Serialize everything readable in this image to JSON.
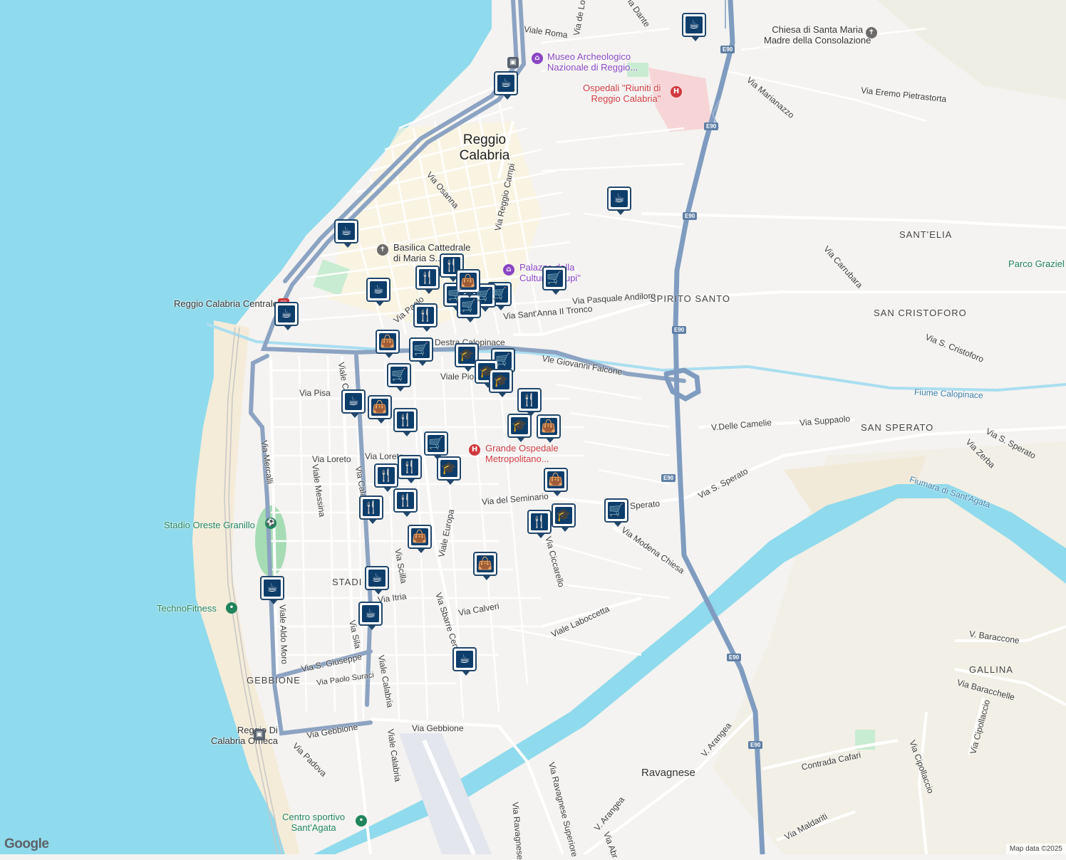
{
  "map": {
    "city_label": "Reggio\nCalabria",
    "places": [
      {
        "id": "ravagnese",
        "label": "Ravagnese"
      }
    ],
    "areas": [
      {
        "id": "santelia",
        "label": "SANT'ELIA"
      },
      {
        "id": "spirito-santo",
        "label": "SPIRITO SANTO"
      },
      {
        "id": "san-cristoforo",
        "label": "SAN CRISTOFORO"
      },
      {
        "id": "san-sperato",
        "label": "SAN SPERATO"
      },
      {
        "id": "stadio",
        "label": "STADI"
      },
      {
        "id": "gebbione",
        "label": "GEBBIONE"
      },
      {
        "id": "gallina",
        "label": "GALLINA"
      }
    ],
    "pois": [
      {
        "id": "museo",
        "label": "Museo Archeologico\nNazionale di Reggio...",
        "color": "purple"
      },
      {
        "id": "ospedali",
        "label": "Ospedali \"Riuniti di\nReggio Calabria\"",
        "color": "red"
      },
      {
        "id": "chiesa",
        "label": "Chiesa di Santa Maria\nMadre della Consolazione",
        "color": "dark"
      },
      {
        "id": "basilica",
        "label": "Basilica Cattedrale\ndi Maria S...",
        "color": "dark"
      },
      {
        "id": "palazzo",
        "label": "Palazzo della\nCultura \"Crupi\"",
        "color": "purple"
      },
      {
        "id": "stazione",
        "label": "Reggio Calabria Centrale",
        "color": "dark"
      },
      {
        "id": "grande-ospedale",
        "label": "Grande Ospedale\nMetropolitano...",
        "color": "red"
      },
      {
        "id": "stadio-granillo",
        "label": "Stadio Oreste Granillo",
        "color": "green"
      },
      {
        "id": "technofitness",
        "label": "TechnoFitness",
        "color": "green"
      },
      {
        "id": "omeca",
        "label": "Reggio Di\nCalabria Omeca",
        "color": "dark"
      },
      {
        "id": "centro-sportivo",
        "label": "Centro sportivo\nSant'Agata",
        "color": "green"
      },
      {
        "id": "parco",
        "label": "Parco Graziel",
        "color": "green"
      }
    ],
    "streets": [
      {
        "id": "viale-roma",
        "label": "Viale Roma"
      },
      {
        "id": "via-de-lo",
        "label": "Via de Lo"
      },
      {
        "id": "via-dante",
        "label": "Via Dante"
      },
      {
        "id": "via-osanna",
        "label": "Via Osanna"
      },
      {
        "id": "via-reggio-campi",
        "label": "Via Reggio Campi"
      },
      {
        "id": "via-marianazzo",
        "label": "Via Marianazzo"
      },
      {
        "id": "via-eremo",
        "label": "Via Eremo Pietrastorta"
      },
      {
        "id": "via-pasquale-andiloro",
        "label": "Via Pasquale Andiloro"
      },
      {
        "id": "via-santanna",
        "label": "Via Sant'Anna II Tronco"
      },
      {
        "id": "via-carrubara",
        "label": "Via Carrubara"
      },
      {
        "id": "via-s-cristoforo",
        "label": "Via S. Cristoforo"
      },
      {
        "id": "via-paolo",
        "label": "Via Paolo"
      },
      {
        "id": "destra-calopinace",
        "label": "Destra Calopinace"
      },
      {
        "id": "vle-giovanni-falcone",
        "label": "Vle Giovanni Falcone"
      },
      {
        "id": "viale-pio",
        "label": "Viale Pio X"
      },
      {
        "id": "fiume-calopinace",
        "label": "Fiume Calopinace"
      },
      {
        "id": "via-pisa",
        "label": "Via Pisa"
      },
      {
        "id": "v-delle-camelie",
        "label": "V.Delle Camelie"
      },
      {
        "id": "via-suppaolo",
        "label": "Via Suppaolo"
      },
      {
        "id": "via-s-sperato-1",
        "label": "Via S. Sperato"
      },
      {
        "id": "via-s-sperato-2",
        "label": "Via S. Sperato"
      },
      {
        "id": "via-zerba",
        "label": "Via Zerba"
      },
      {
        "id": "fiumara",
        "label": "Fiumara di Sant'Agata"
      },
      {
        "id": "via-loreto-1",
        "label": "Via Loreto"
      },
      {
        "id": "via-loreto-2",
        "label": "Via Loreto"
      },
      {
        "id": "via-del-seminario",
        "label": "Via del Seminario"
      },
      {
        "id": "via-sperato-short",
        "label": "Sperato"
      },
      {
        "id": "via-modena-chiesa",
        "label": "Via Modena Chiesa"
      },
      {
        "id": "viale-europa",
        "label": "Viale Europa"
      },
      {
        "id": "via-ciccarello",
        "label": "Via Ciccarello"
      },
      {
        "id": "viale-messina",
        "label": "Viale Messina"
      },
      {
        "id": "via-mercalli",
        "label": "Via Mercalli"
      },
      {
        "id": "via-scilla",
        "label": "Via Scilla"
      },
      {
        "id": "via-itria",
        "label": "Via Itria"
      },
      {
        "id": "via-calveri",
        "label": "Via Calveri"
      },
      {
        "id": "viale-laboccetta",
        "label": "Viale Laboccetta"
      },
      {
        "id": "via-sbarre-centrali",
        "label": "Via Sbarre Centrali"
      },
      {
        "id": "viale-aldo-moro",
        "label": "Viale Aldo Moro"
      },
      {
        "id": "via-sila",
        "label": "Via Sila"
      },
      {
        "id": "via-s-giuseppe",
        "label": "Via S. Giuseppe"
      },
      {
        "id": "via-paolo-suraci",
        "label": "Via Paolo Suraci"
      },
      {
        "id": "viale-calabria-1",
        "label": "Viale Calabria"
      },
      {
        "id": "viale-calabria-2",
        "label": "Viale Calabria"
      },
      {
        "id": "via-gebbione-1",
        "label": "Via Gebbione"
      },
      {
        "id": "via-gebbione-2",
        "label": "Via Gebbione"
      },
      {
        "id": "via-padova",
        "label": "Via Padova"
      },
      {
        "id": "via-ravagnese-sup",
        "label": "Via Ravagnese Superiore"
      },
      {
        "id": "via-ravagnese",
        "label": "Via Ravagnese"
      },
      {
        "id": "v-arangea-1",
        "label": "V. Arangea"
      },
      {
        "id": "v-arangea-2",
        "label": "V. Arangea"
      },
      {
        "id": "via-abr",
        "label": "Via Abr"
      },
      {
        "id": "contrada-cafari",
        "label": "Contrada Cafari"
      },
      {
        "id": "via-maldariti",
        "label": "Via Maldariti"
      },
      {
        "id": "via-cipollaccio-1",
        "label": "Via Cipollaccio"
      },
      {
        "id": "via-cipollaccio-2",
        "label": "Via Cipollaccio"
      },
      {
        "id": "v-baraccone",
        "label": "V. Baraccone"
      },
      {
        "id": "via-baracchelle",
        "label": "Via Baracchelle"
      },
      {
        "id": "viale-ce",
        "label": "Viale Ce"
      },
      {
        "id": "via-calabria-short",
        "label": "Via Calabria"
      }
    ],
    "highway_shield": "E90",
    "markers": {
      "coffee": "☕",
      "restaurant": "🍴",
      "cart": "🛒",
      "bag": "👜",
      "school": "🎓"
    },
    "attribution": "Map data ©2025",
    "google": "Google"
  }
}
